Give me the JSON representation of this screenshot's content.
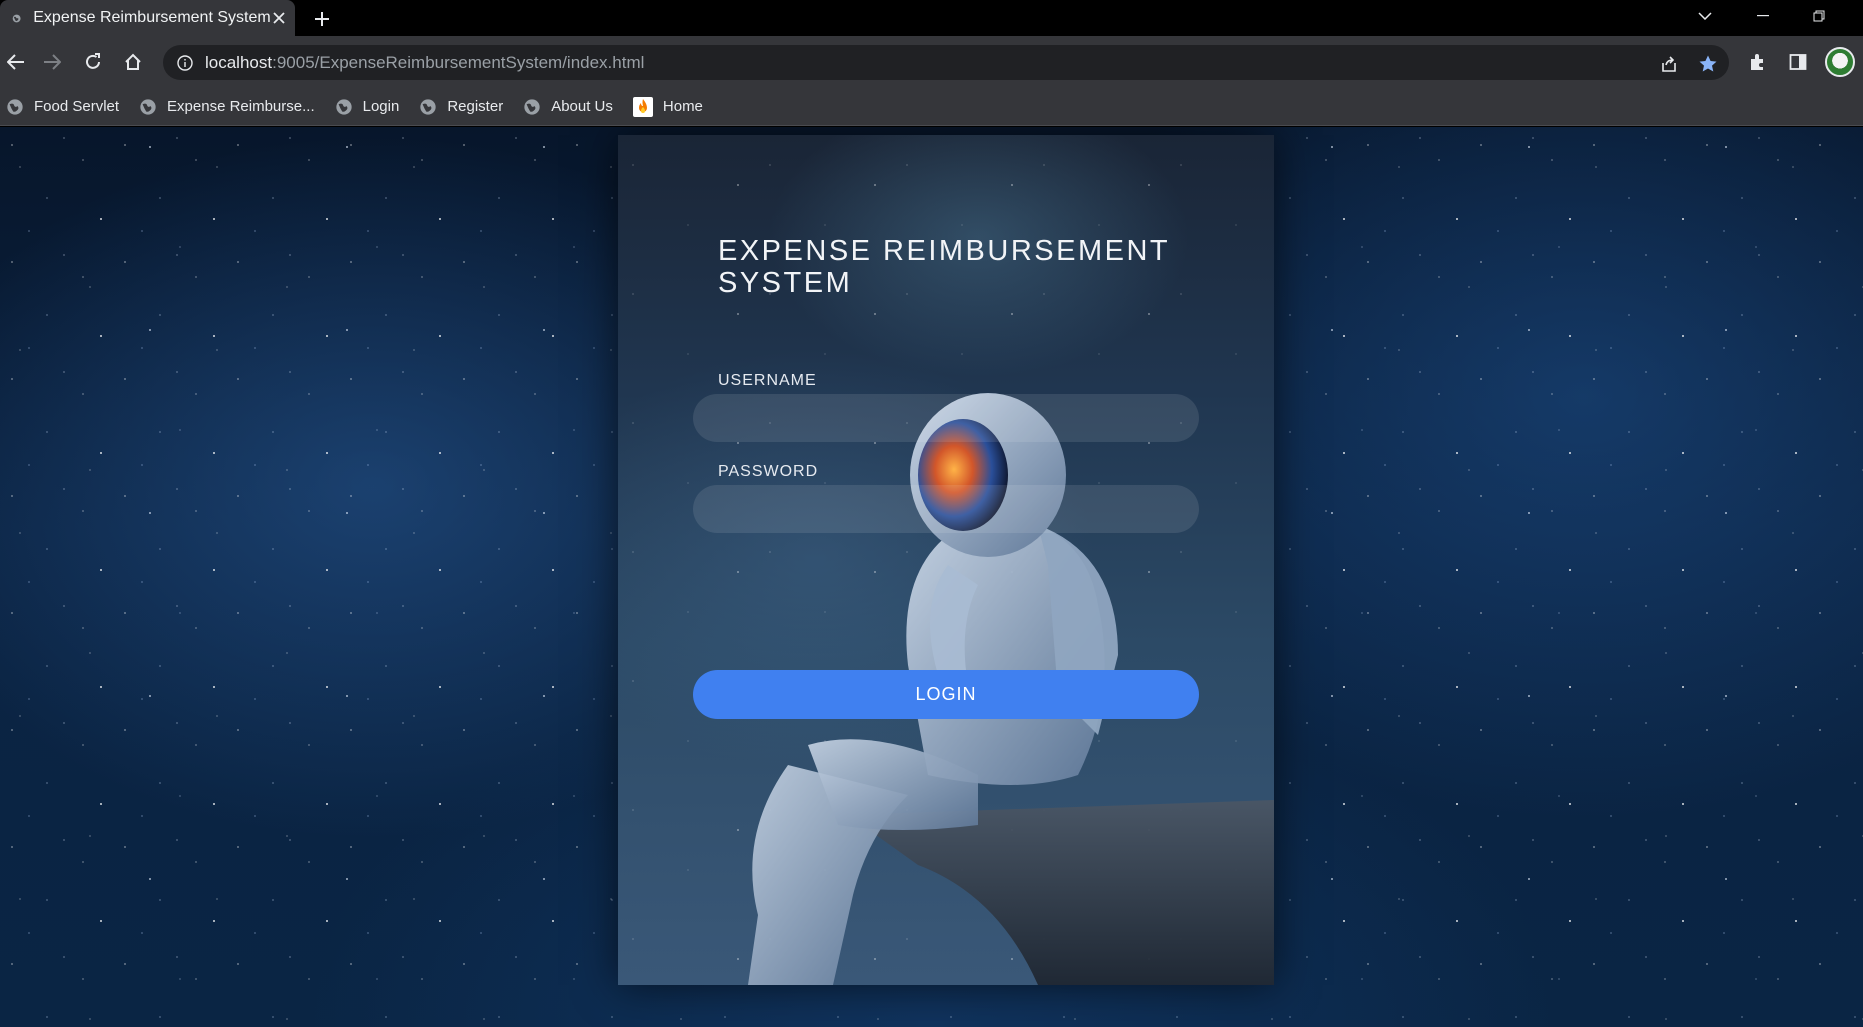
{
  "browser": {
    "tab_title": "Expense Reimbursement System",
    "url_host": "localhost",
    "url_path": ":9005/ExpenseReimbursementSystem/index.html",
    "bookmarks": [
      {
        "label": "Food Servlet",
        "icon": "globe-icon"
      },
      {
        "label": "Expense Reimburse...",
        "icon": "globe-icon"
      },
      {
        "label": "Login",
        "icon": "globe-icon"
      },
      {
        "label": "Register",
        "icon": "globe-icon"
      },
      {
        "label": "About Us",
        "icon": "globe-icon"
      },
      {
        "label": "Home",
        "icon": "fire-icon"
      }
    ],
    "accent": "#8ab4f8"
  },
  "login": {
    "title": "EXPENSE REIMBURSEMENT SYSTEM",
    "username_label": "USERNAME",
    "username_value": "",
    "password_label": "PASSWORD",
    "password_value": "",
    "button_label": "LOGIN",
    "button_color": "#4080f0"
  }
}
